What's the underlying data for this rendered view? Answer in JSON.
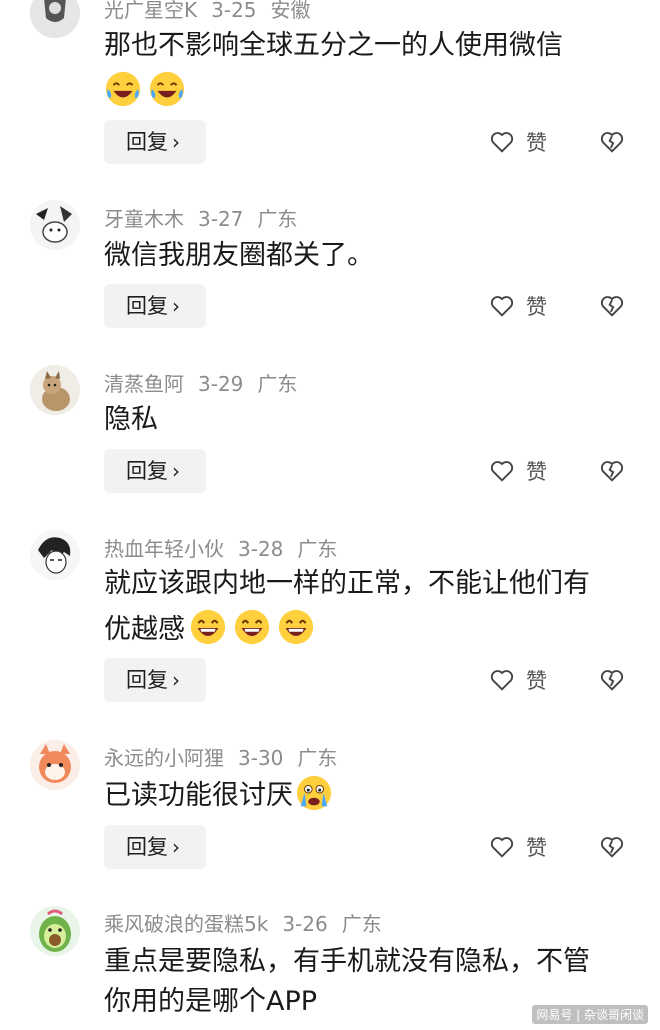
{
  "comments": [
    {
      "author": "光广星空K",
      "date": "3-25",
      "location": "安徽",
      "text": "那也不影响全球五分之一的人使用微信",
      "emojis": [
        "laugh-cry",
        "laugh-cry"
      ],
      "reply_label": "回复",
      "like_label": "赞"
    },
    {
      "author": "牙童木木",
      "date": "3-27",
      "location": "广东",
      "text": "微信我朋友圈都关了。",
      "emojis": [],
      "reply_label": "回复",
      "like_label": "赞"
    },
    {
      "author": "清蒸鱼阿",
      "date": "3-29",
      "location": "广东",
      "text": "隐私",
      "emojis": [],
      "reply_label": "回复",
      "like_label": "赞"
    },
    {
      "author": "热血年轻小伙",
      "date": "3-28",
      "location": "广东",
      "text_line1": "就应该跟内地一样的正常，不能让他们有",
      "text_line2": "优越感",
      "emojis": [
        "laugh",
        "laugh",
        "laugh"
      ],
      "reply_label": "回复",
      "like_label": "赞"
    },
    {
      "author": "永远的小阿狸",
      "date": "3-30",
      "location": "广东",
      "text": "已读功能很讨厌",
      "emojis": [
        "crying"
      ],
      "reply_label": "回复",
      "like_label": "赞"
    },
    {
      "author": "乘风破浪的蛋糕5k",
      "date": "3-26",
      "location": "广东",
      "text_line1": "重点是要隐私，有手机就没有隐私，不管",
      "text_line2": "你用的是哪个APP",
      "emojis": []
    }
  ],
  "icons": {
    "like": "heart-outline-icon",
    "dislike": "broken-heart-icon",
    "reply_chevron": "chevron-right-icon"
  },
  "watermark": "网易号 | 杂谈哥闲谈"
}
